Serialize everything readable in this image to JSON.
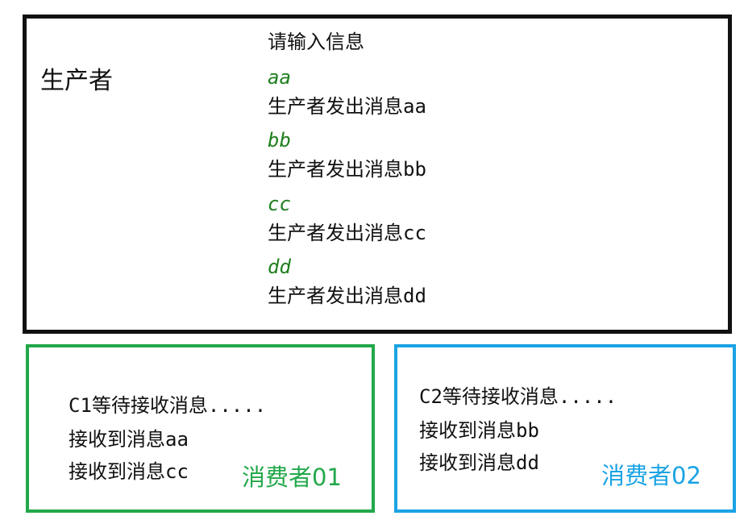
{
  "producer": {
    "title": "生产者",
    "prompt": "请输入信息",
    "lines": [
      "aa",
      "生产者发出消息aa",
      "bb",
      "生产者发出消息bb",
      "cc",
      "生产者发出消息cc",
      "dd",
      "生产者发出消息dd"
    ]
  },
  "consumers": [
    {
      "name": "消费者01",
      "color": "#22a84a",
      "lines": [
        "C1等待接收消息.....",
        "接收到消息aa",
        "接收到消息cc"
      ]
    },
    {
      "name": "消费者02",
      "color": "#1aa3e4",
      "lines": [
        "C2等待接收消息.....",
        "接收到消息bb",
        "接收到消息dd"
      ]
    }
  ],
  "colors": {
    "producer_border": "#111111",
    "input_text": "#1e7f1e"
  }
}
